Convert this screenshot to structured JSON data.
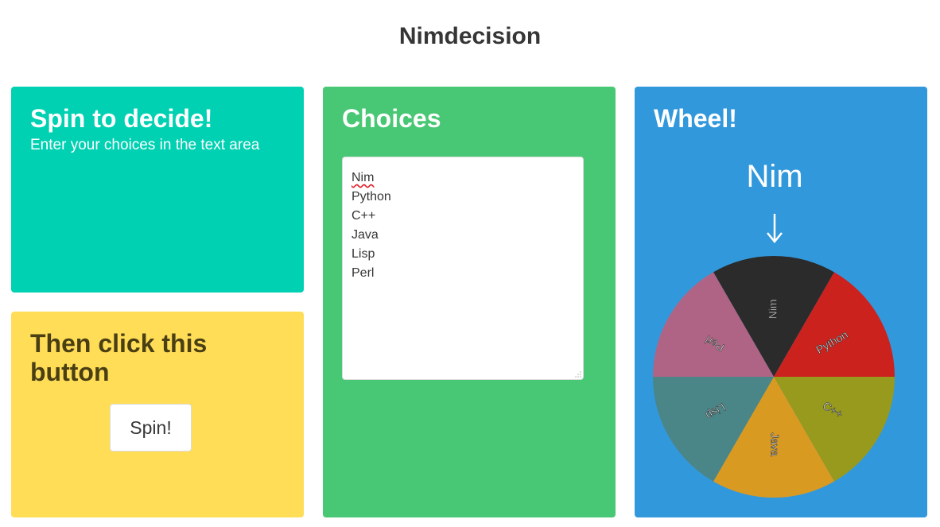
{
  "header": {
    "title": "Nimdecision"
  },
  "spin_card": {
    "title": "Spin to decide!",
    "subtitle": "Enter your choices in the text area"
  },
  "button_card": {
    "title": "Then click this button",
    "spin_label": "Spin!"
  },
  "choices_card": {
    "title": "Choices",
    "choices": [
      "Nim",
      "Python",
      "C++",
      "Java",
      "Lisp",
      "Perl"
    ]
  },
  "wheel_card": {
    "title": "Wheel!",
    "winner": "Nim",
    "pointer_icon": "arrow-down-icon",
    "segments": [
      {
        "label": "Nim",
        "color": "#2b2b2b"
      },
      {
        "label": "Python",
        "color": "#cc221e"
      },
      {
        "label": "C++",
        "color": "#979a1c"
      },
      {
        "label": "Java",
        "color": "#d99a22"
      },
      {
        "label": "Lisp",
        "color": "#4a8587"
      },
      {
        "label": "Perl",
        "color": "#b06485"
      }
    ]
  },
  "colors": {
    "turquoise": "#00d1b2",
    "yellow": "#ffdd57",
    "green": "#48c774",
    "blue": "#3298dc"
  }
}
